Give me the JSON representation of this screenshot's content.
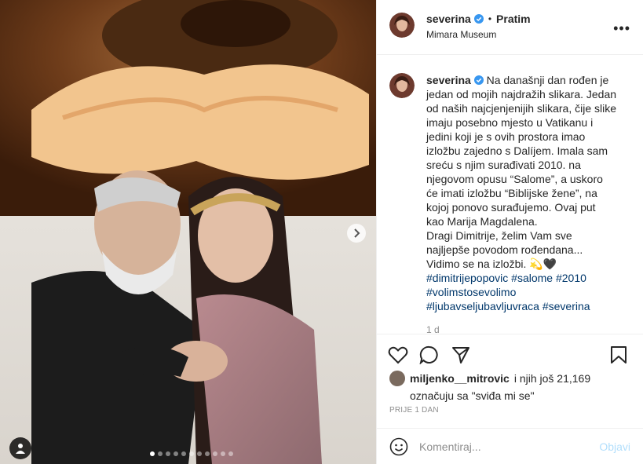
{
  "post": {
    "username": "severina",
    "follow_separator": "•",
    "follow_label": "Pratim",
    "location": "Mimara Museum",
    "more_label": "•••",
    "caption_lines": [
      "Na današnji dan rođen je",
      "jedan od mojih najdražih slikara. Jedan",
      "od naših najcjenjenijih slikara, čije slike",
      "imaju posebno mjesto u Vatikanu i",
      "jedini koji je s ovih prostora imao",
      "izložbu zajedno s Dalíjem. Imala sam",
      "sreću s njim surađivati 2010. na",
      "njegovom opusu “Salome”, a uskoro",
      "će imati izložbu “Biblijske žene”, na",
      "kojoj ponovo surađujemo. Ovaj put",
      "kao Marija Magdalena.",
      "Dragi Dimitrije, želim Vam sve",
      "najljepše povodom rođendana...",
      "Vidimo se na izložbi. 💫🖤"
    ],
    "hashtags": [
      "#dimitrijepopovic #salome #2010",
      "#volimstosevolimo",
      "#ljubavseljubavljuvraca #severina"
    ],
    "caption_time": "1 d",
    "liked_by_user": "miljenko__mitrovic",
    "liked_by_rest": "i njih još 21,169",
    "liked_suffix": "označuju sa \"sviđa mi se\"",
    "posted_ago": "PRIJE 1 DAN",
    "comment_placeholder": "Komentiraj...",
    "post_button": "Objavi"
  },
  "carousel": {
    "total": 11,
    "active_index": 0
  },
  "colors": {
    "verified": "#3897f0",
    "link": "#00376b",
    "muted": "#8e8e8e",
    "post_disabled": "#b2dffc"
  },
  "icons": [
    "verified-badge-icon",
    "heart-icon",
    "comment-icon",
    "share-icon",
    "bookmark-icon",
    "emoji-icon",
    "chevron-right-icon",
    "user-tag-icon"
  ]
}
